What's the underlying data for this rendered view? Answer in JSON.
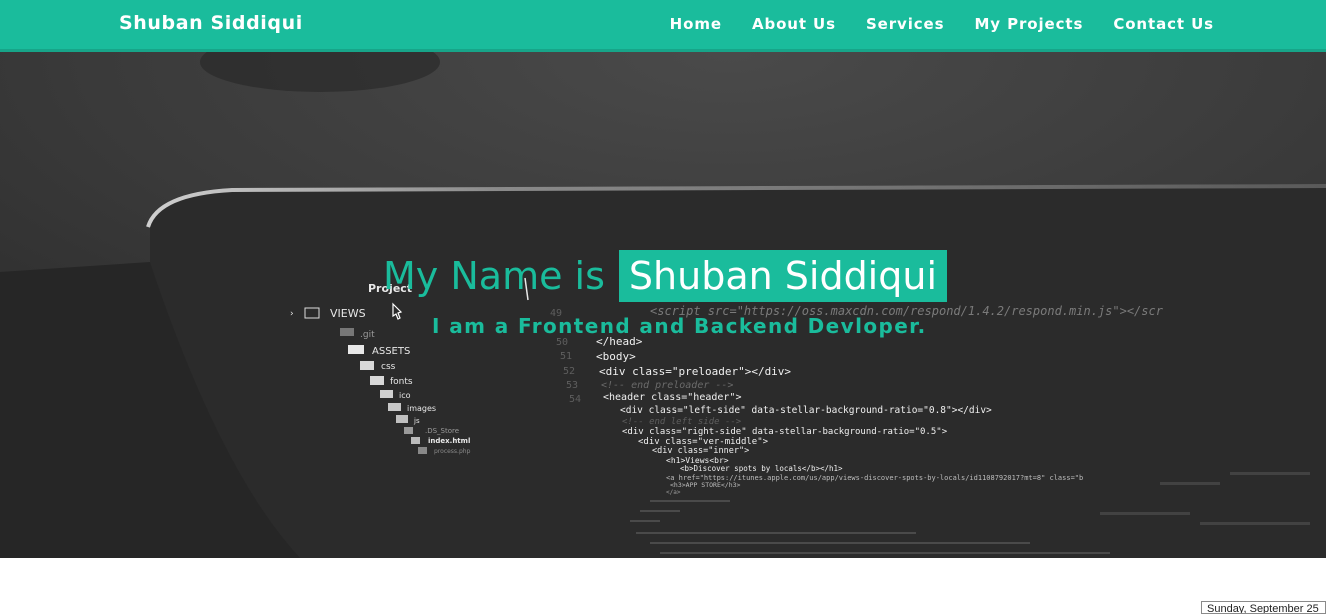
{
  "nav": {
    "brand": "Shuban Siddiqui",
    "links": [
      "Home",
      "About Us",
      "Services",
      "My Projects",
      "Contact Us"
    ]
  },
  "hero": {
    "title_lead": "My Name is",
    "title_name": "Shuban Siddiqui",
    "subtitle": "I am a Frontend and Backend Devloper.",
    "background": {
      "tree": {
        "project": "Project",
        "views": "VIEWS",
        "items": [
          ".git",
          "ASSETS",
          "css",
          "fonts",
          "ico",
          "images",
          "js",
          ".DS_Store",
          "index.html",
          "process.php"
        ]
      },
      "code_lines": [
        "<script src=\"https://oss.maxcdn.com/respond/1.4.2/respond.min.js\"></scr",
        "</head>",
        "<body>",
        "<div class=\"preloader\"></div>",
        "<!-- end preloader -->",
        "<header class=\"header\">",
        "<div class=\"left-side\" data-stellar-background-ratio=\"0.8\"></div>",
        "<!-- end left side -->",
        "<div class=\"right-side\" data-stellar-background-ratio=\"0.5\">",
        "<div class=\"ver-middle\">",
        "<div class=\"inner\">",
        "<h1>Views<br>",
        "<b>Discover spots by locals</b></h1>",
        "<a href=\"https://itunes.apple.com/us/app/views-discover-spots-by-locals/id1108792017?mt=8\" class=\"b",
        "<h3>APP STORE</h3>",
        "</a>"
      ],
      "line_numbers": [
        "49",
        "50",
        "51",
        "52",
        "53",
        "54"
      ]
    }
  },
  "footer": {
    "date_text": "Sunday, September 25"
  },
  "colors": {
    "accent": "#1abc9c",
    "hero_bg": "#262626",
    "text_light": "#ffffff"
  }
}
